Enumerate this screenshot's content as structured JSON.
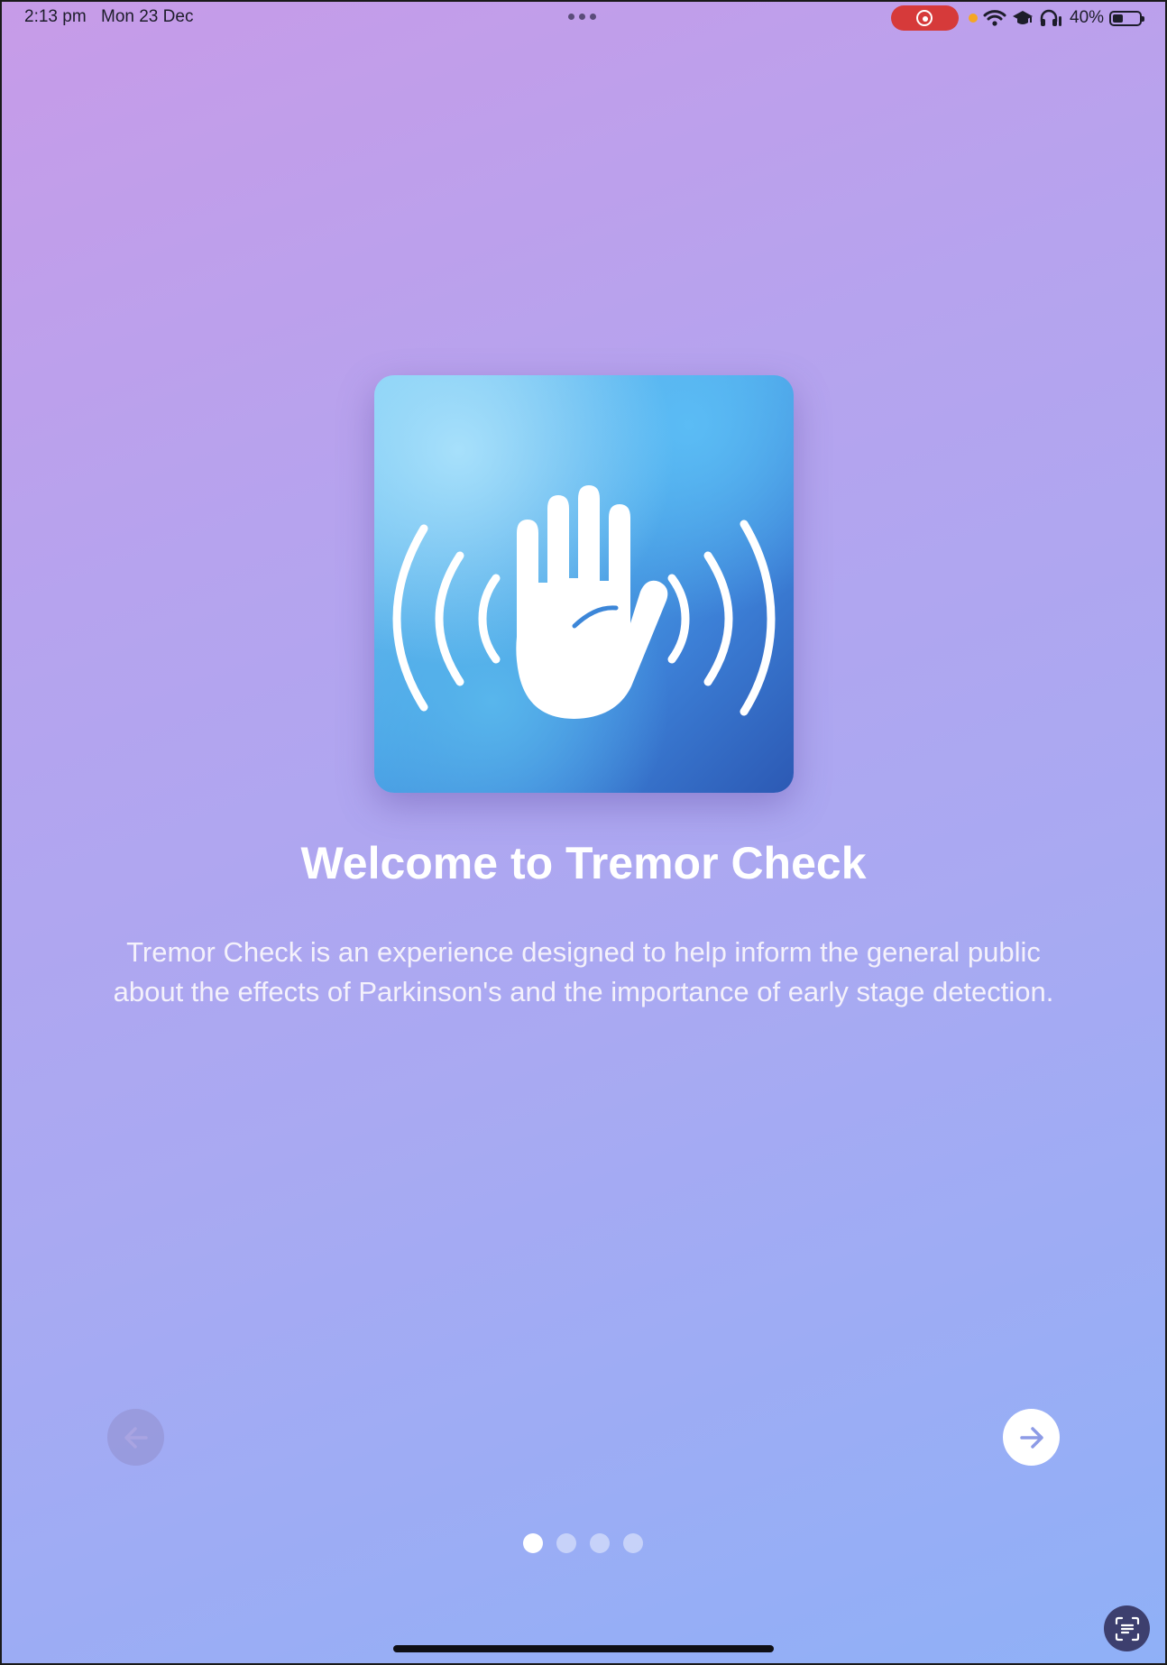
{
  "status_bar": {
    "time": "2:13 pm",
    "date": "Mon 23 Dec",
    "battery_percent": "40%",
    "battery_level": 0.4
  },
  "onboarding": {
    "title": "Welcome to Tremor Check",
    "description": "Tremor Check is an experience designed to help inform the general public about the effects of Parkinson's and the importance of early stage detection.",
    "current_page": 1,
    "total_pages": 4
  },
  "icons": {
    "app_icon": "hand-tremor-icon",
    "prev": "arrow-left-icon",
    "next": "arrow-right-icon",
    "live_text": "live-text-icon"
  },
  "colors": {
    "background_top": "#c79be8",
    "background_bottom": "#8fb0f7",
    "icon_blue": "#3c7fd6",
    "record_red": "#d63a3a"
  }
}
